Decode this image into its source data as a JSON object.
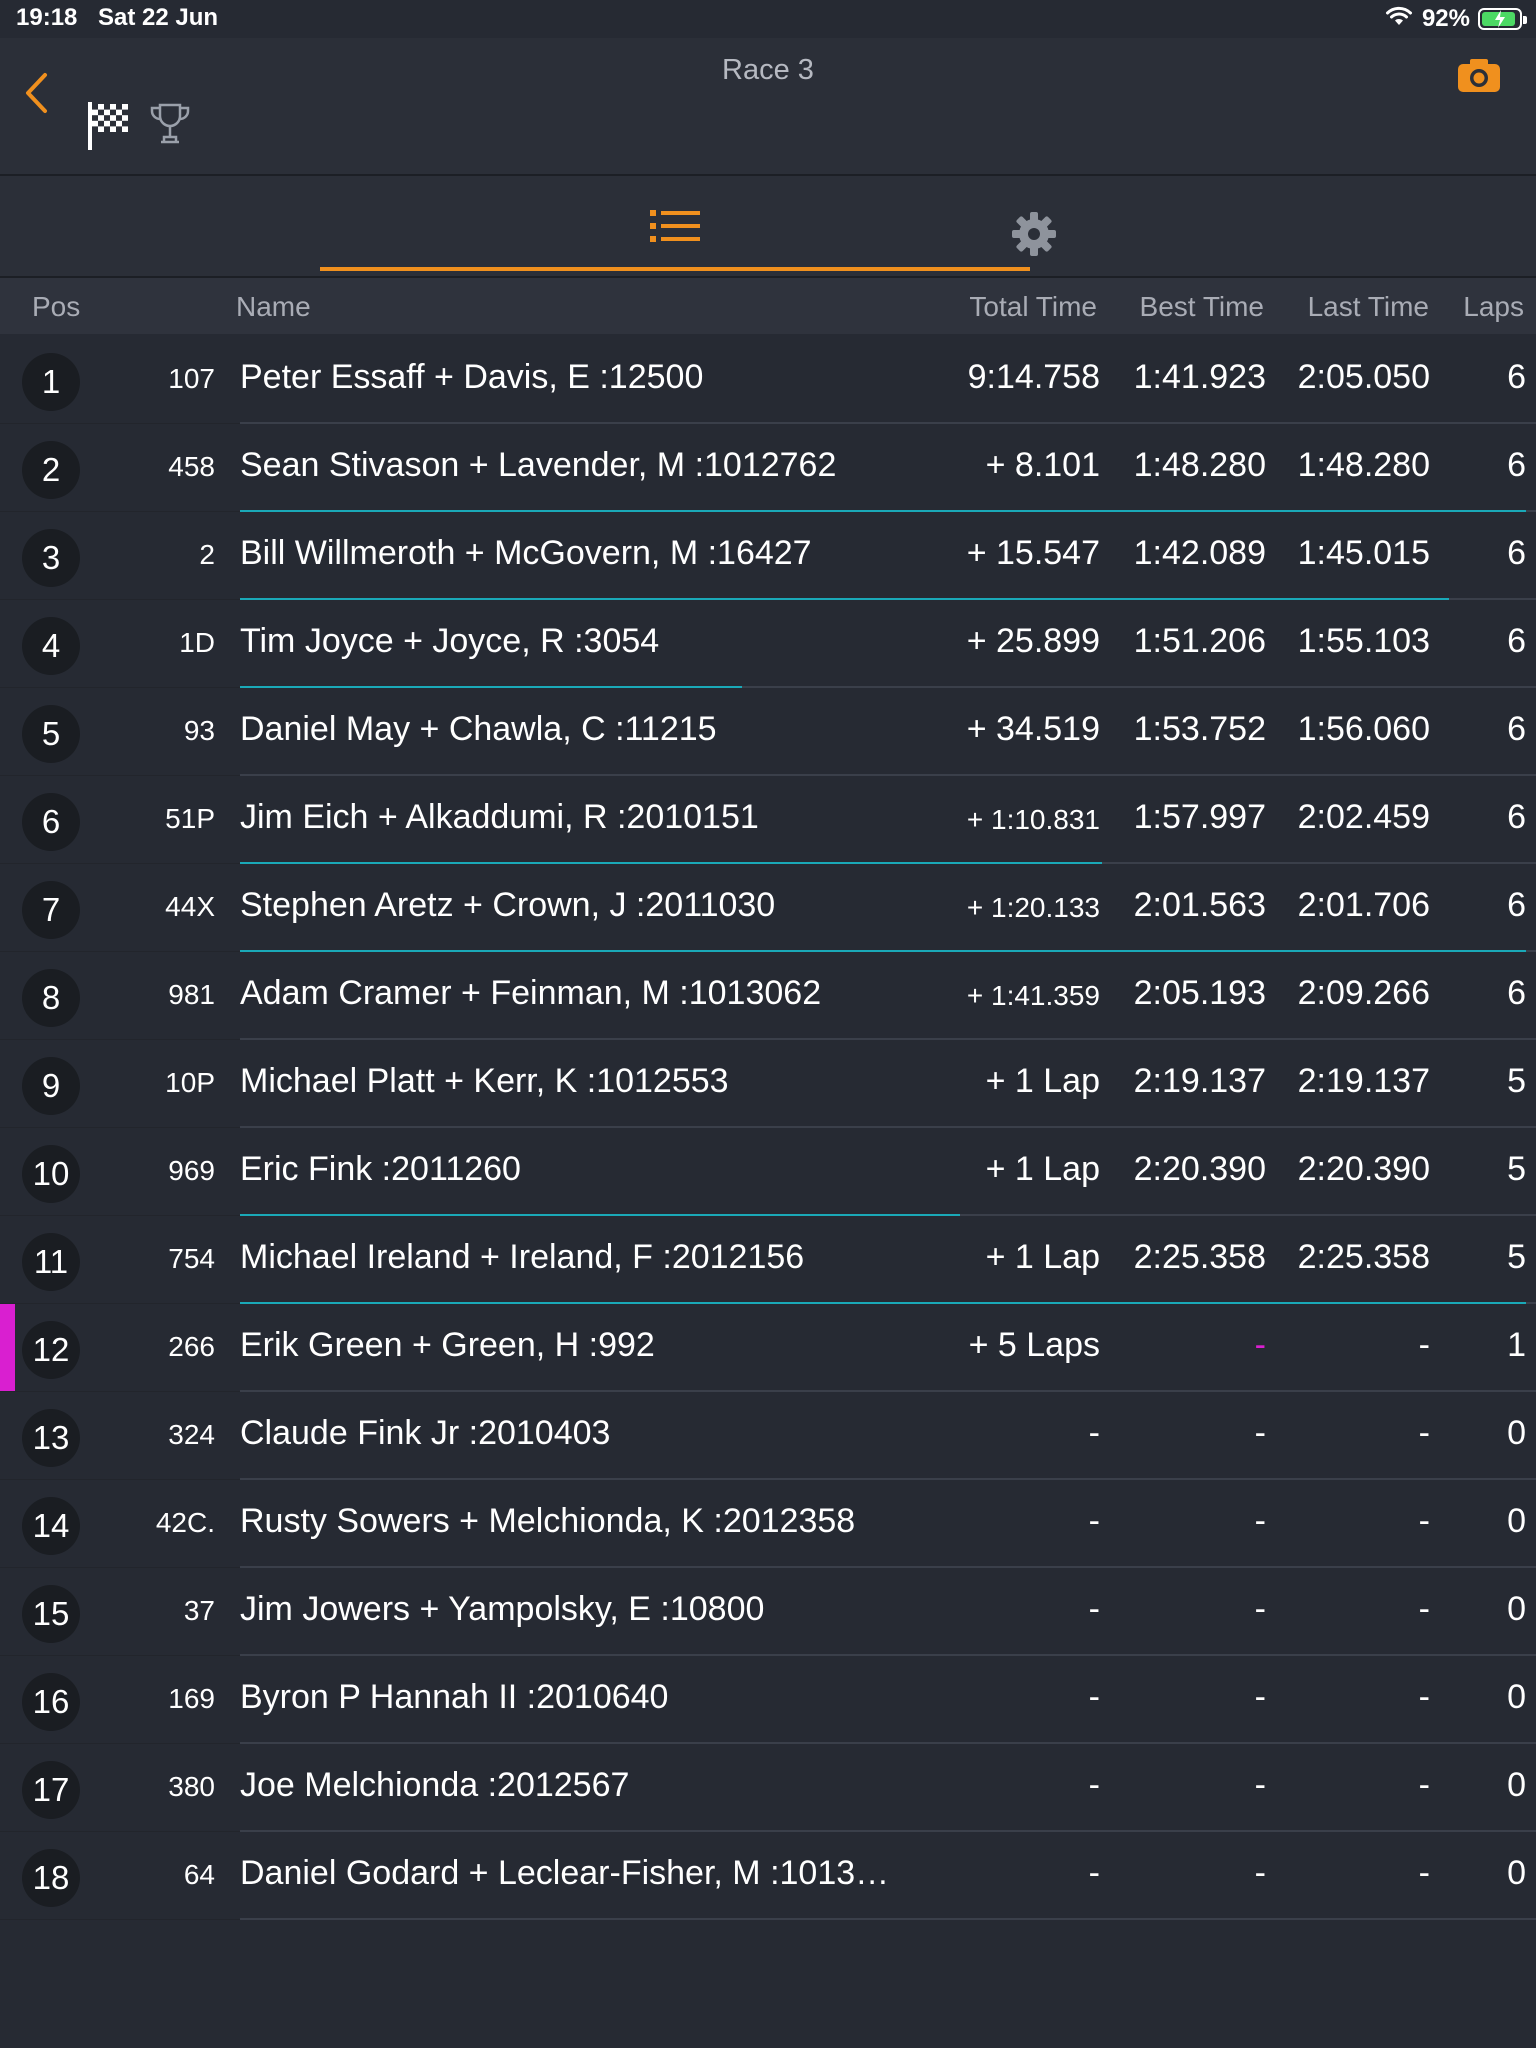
{
  "status_bar": {
    "time": "19:18",
    "date": "Sat 22 Jun",
    "battery": "92%",
    "battery_level": 0.92
  },
  "nav": {
    "title": "Race 3"
  },
  "colors": {
    "accent": "#f0901e",
    "gap_line": "#1aa9b8",
    "highlight": "#d91fd0"
  },
  "table": {
    "headers": {
      "pos": "Pos",
      "name": "Name",
      "total": "Total Time",
      "best": "Best Time",
      "last": "Last Time",
      "laps": "Laps"
    },
    "rows": [
      {
        "pos": "1",
        "num": "107",
        "name": "Peter Essaff + Davis, E :12500",
        "total": "9:14.758",
        "best": "1:41.923",
        "last": "2:05.050",
        "laps": "6",
        "gap": 0
      },
      {
        "pos": "2",
        "num": "458",
        "name": "Sean Stivason + Lavender, M :1012762",
        "total": "+ 8.101",
        "best": "1:48.280",
        "last": "1:48.280",
        "laps": "6",
        "gap": 1.0
      },
      {
        "pos": "3",
        "num": "2",
        "name": "Bill Willmeroth + McGovern, M :16427",
        "total": "+ 15.547",
        "best": "1:42.089",
        "last": "1:45.015",
        "laps": "6",
        "gap": 0.94
      },
      {
        "pos": "4",
        "num": "1D",
        "name": "Tim Joyce + Joyce, R :3054",
        "total": "+ 25.899",
        "best": "1:51.206",
        "last": "1:55.103",
        "laps": "6",
        "gap": 0.39
      },
      {
        "pos": "5",
        "num": "93",
        "name": "Daniel May + Chawla, C :11215",
        "total": "+ 34.519",
        "best": "1:53.752",
        "last": "1:56.060",
        "laps": "6",
        "gap": 0
      },
      {
        "pos": "6",
        "num": "51P",
        "name": "Jim Eich + Alkaddumi, R :2010151",
        "total": "+ 1:10.831",
        "best": "1:57.997",
        "last": "2:02.459",
        "laps": "6",
        "gap": 0.67,
        "small_total": true
      },
      {
        "pos": "7",
        "num": "44X",
        "name": "Stephen Aretz + Crown, J :2011030",
        "total": "+ 1:20.133",
        "best": "2:01.563",
        "last": "2:01.706",
        "laps": "6",
        "gap": 1.0,
        "small_total": true
      },
      {
        "pos": "8",
        "num": "981",
        "name": "Adam Cramer + Feinman, M :1013062",
        "total": "+ 1:41.359",
        "best": "2:05.193",
        "last": "2:09.266",
        "laps": "6",
        "gap": 0,
        "small_total": true
      },
      {
        "pos": "9",
        "num": "10P",
        "name": "Michael Platt + Kerr, K :1012553",
        "total": "+ 1 Lap",
        "best": "2:19.137",
        "last": "2:19.137",
        "laps": "5",
        "gap": 0
      },
      {
        "pos": "10",
        "num": "969",
        "name": "Eric Fink :2011260",
        "total": "+ 1 Lap",
        "best": "2:20.390",
        "last": "2:20.390",
        "laps": "5",
        "gap": 0.56
      },
      {
        "pos": "11",
        "num": "754",
        "name": "Michael Ireland + Ireland, F :2012156",
        "total": "+ 1 Lap",
        "best": "2:25.358",
        "last": "2:25.358",
        "laps": "5",
        "gap": 1.0
      },
      {
        "pos": "12",
        "num": "266",
        "name": "Erik Green + Green, H :992",
        "total": "+ 5 Laps",
        "best": "-",
        "last": "-",
        "laps": "1",
        "gap": 0,
        "highlight": true
      },
      {
        "pos": "13",
        "num": "324",
        "name": "Claude Fink Jr :2010403",
        "total": "-",
        "best": "-",
        "last": "-",
        "laps": "0",
        "gap": 0
      },
      {
        "pos": "14",
        "num": "42C.",
        "name": "Rusty Sowers + Melchionda, K :2012358",
        "total": "-",
        "best": "-",
        "last": "-",
        "laps": "0",
        "gap": 0
      },
      {
        "pos": "15",
        "num": "37",
        "name": "Jim Jowers + Yampolsky, E :10800",
        "total": "-",
        "best": "-",
        "last": "-",
        "laps": "0",
        "gap": 0
      },
      {
        "pos": "16",
        "num": "169",
        "name": "Byron P Hannah II :2010640",
        "total": "-",
        "best": "-",
        "last": "-",
        "laps": "0",
        "gap": 0
      },
      {
        "pos": "17",
        "num": "380",
        "name": "Joe Melchionda :2012567",
        "total": "-",
        "best": "-",
        "last": "-",
        "laps": "0",
        "gap": 0
      },
      {
        "pos": "18",
        "num": "64",
        "name": "Daniel Godard + Leclear-Fisher, M :1013…",
        "total": "-",
        "best": "-",
        "last": "-",
        "laps": "0",
        "gap": 0
      }
    ]
  }
}
